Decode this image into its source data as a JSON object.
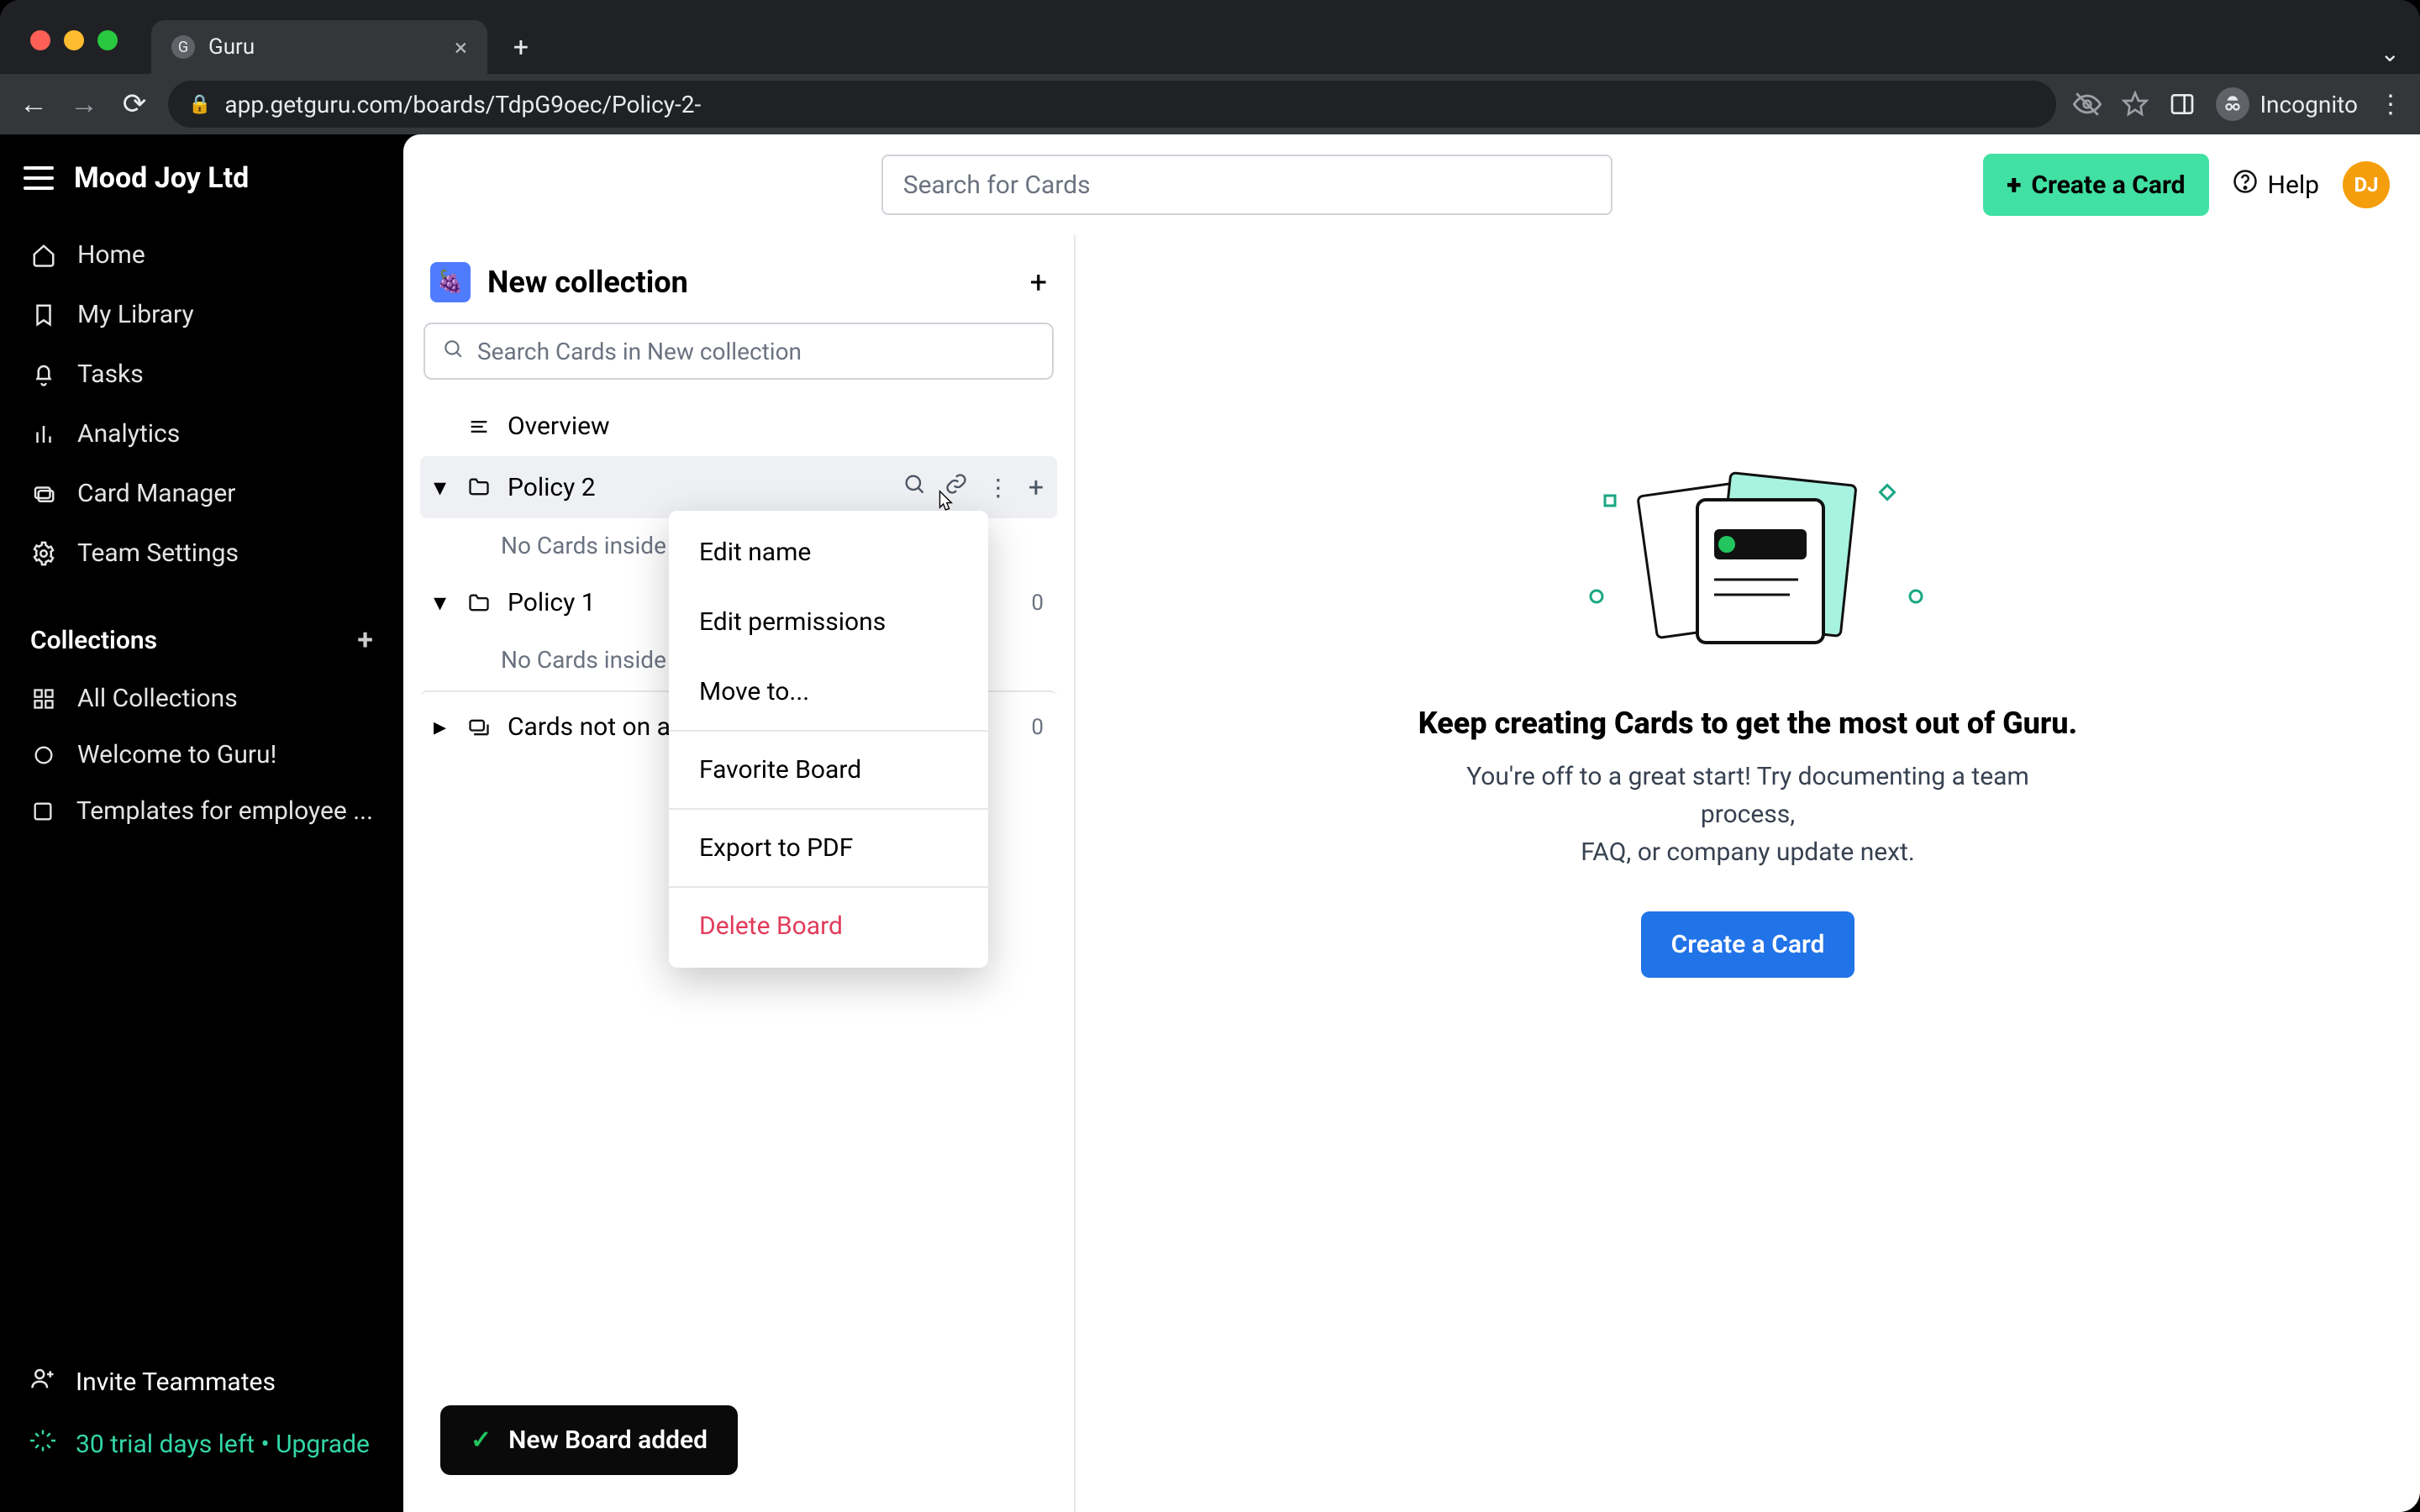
{
  "browser": {
    "tab_title": "Guru",
    "url": "app.getguru.com/boards/TdpG9oec/Policy-2-",
    "incognito_label": "Incognito"
  },
  "sidebar": {
    "org_name": "Mood Joy Ltd",
    "nav": [
      {
        "label": "Home"
      },
      {
        "label": "My Library"
      },
      {
        "label": "Tasks"
      },
      {
        "label": "Analytics"
      },
      {
        "label": "Card Manager"
      },
      {
        "label": "Team Settings"
      }
    ],
    "collections_title": "Collections",
    "collections": [
      {
        "label": "All Collections"
      },
      {
        "label": "Welcome to Guru!"
      },
      {
        "label": "Templates for employee ..."
      }
    ],
    "footer": {
      "invite": "Invite Teammates",
      "trial": "30 trial days left • Upgrade"
    }
  },
  "topbar": {
    "search_placeholder": "Search for Cards",
    "create_label": "Create a Card",
    "help_label": "Help",
    "avatar_initials": "DJ"
  },
  "panel": {
    "collection_name": "New collection",
    "search_placeholder": "Search Cards in New collection",
    "overview": "Overview",
    "boards": [
      {
        "name": "Policy 2",
        "empty": "No Cards inside"
      },
      {
        "name": "Policy 1",
        "empty": "No Cards inside",
        "count": "0"
      }
    ],
    "unassigned": {
      "label": "Cards not on a B",
      "count": "0"
    }
  },
  "menu": {
    "edit_name": "Edit name",
    "edit_perm": "Edit permissions",
    "move": "Move to...",
    "favorite": "Favorite Board",
    "export": "Export to PDF",
    "delete": "Delete Board"
  },
  "empty": {
    "title": "Keep creating Cards to get the most out of Guru.",
    "body_line1": "You're off to a great start! Try documenting a team process,",
    "body_line2": "FAQ, or company update next.",
    "cta": "Create a Card"
  },
  "toast": {
    "text": "New Board added"
  }
}
